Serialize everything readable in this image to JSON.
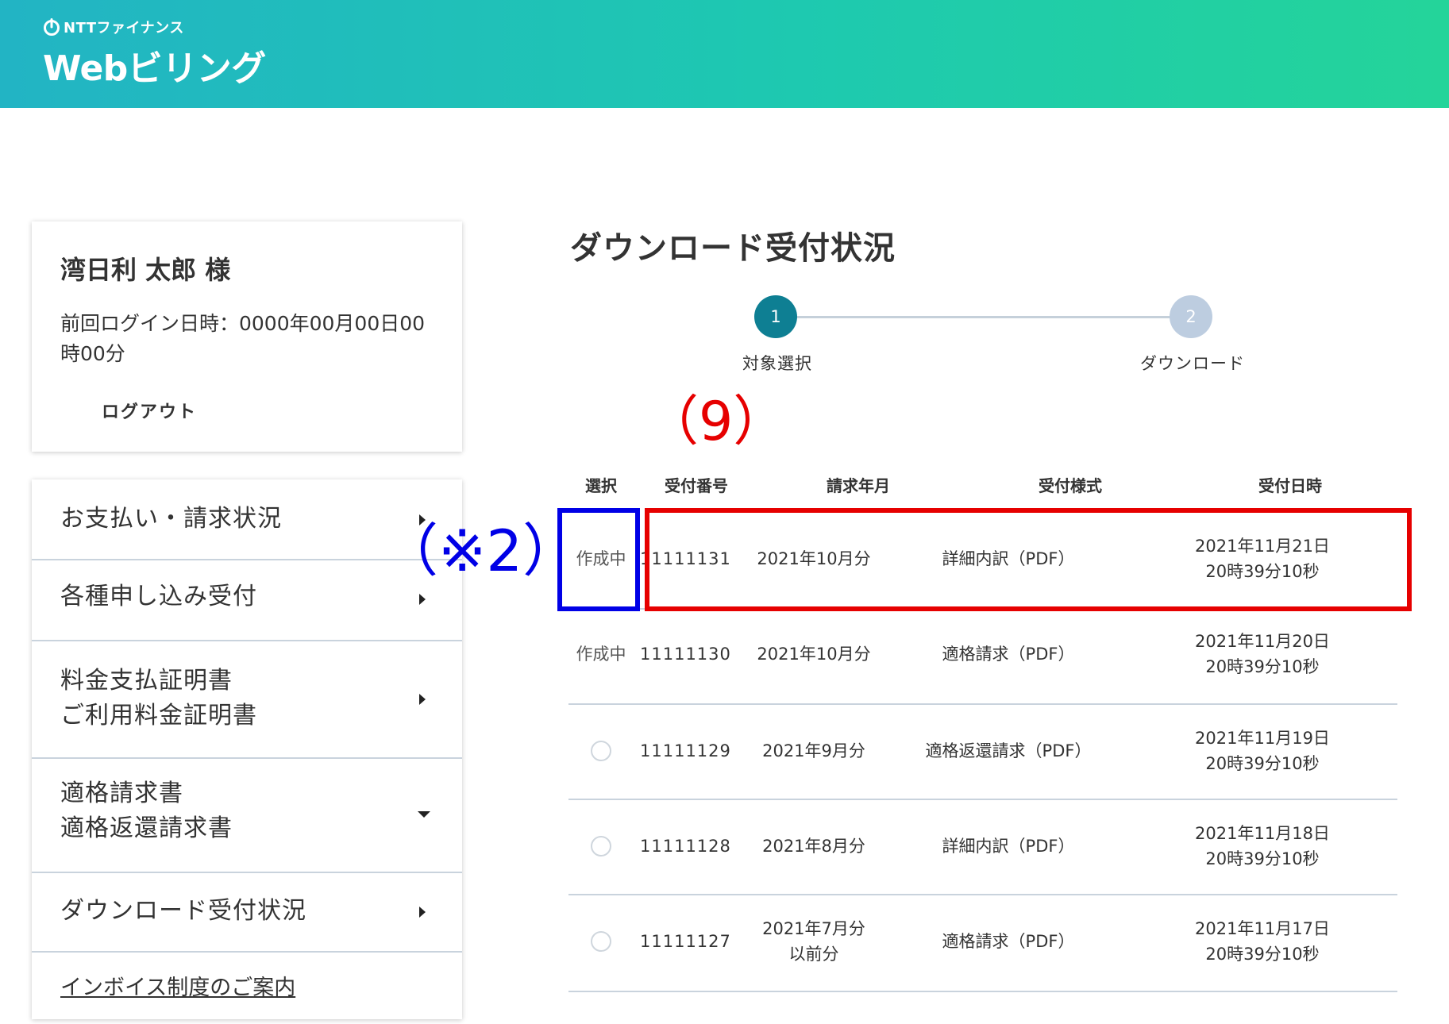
{
  "header": {
    "corp_name": "NTTファイナンス",
    "product_name": "Webビリング"
  },
  "user": {
    "name": "湾日利 太郎 様",
    "last_login": "前回ログイン日時：0000年00月00日00時00分",
    "logout_label": "ログアウト"
  },
  "sidebar": {
    "items": [
      {
        "label": "お支払い・請求状況"
      },
      {
        "label": "各種申し込み受付"
      },
      {
        "label_line1": "料金支払証明書",
        "label_line2": "ご利用料金証明書"
      },
      {
        "label_line1": "適格請求書",
        "label_line2": "適格返還請求書"
      },
      {
        "label": "ダウンロード受付状況"
      }
    ],
    "invoice_link": "インボイス制度のご案内"
  },
  "main": {
    "title": "ダウンロード受付状況",
    "steps": [
      {
        "number": "1",
        "label": "対象選択"
      },
      {
        "number": "2",
        "label": "ダウンロード"
      }
    ],
    "table": {
      "headers": [
        "選択",
        "受付番号",
        "請求年月",
        "受付様式",
        "受付日時"
      ],
      "rows": [
        {
          "select": "作成中",
          "number": "11111131",
          "month": "2021年10月分",
          "form": "詳細内訳（PDF）",
          "date_line1": "2021年11月21日",
          "date_line2": "20時39分10秒"
        },
        {
          "select": "作成中",
          "number": "11111130",
          "month": "2021年10月分",
          "form": "適格請求（PDF）",
          "date_line1": "2021年11月20日",
          "date_line2": "20時39分10秒"
        },
        {
          "select": "",
          "number": "11111129",
          "month": "2021年9月分",
          "form": "適格返還請求（PDF）",
          "date_line1": "2021年11月19日",
          "date_line2": "20時39分10秒"
        },
        {
          "select": "",
          "number": "11111128",
          "month": "2021年8月分",
          "form": "詳細内訳（PDF）",
          "date_line1": "2021年11月18日",
          "date_line2": "20時39分10秒"
        },
        {
          "select": "",
          "number": "11111127",
          "month_line1": "2021年7月分",
          "month_line2": "以前分",
          "form": "適格請求（PDF）",
          "date_line1": "2021年11月17日",
          "date_line2": "20時39分10秒"
        }
      ]
    }
  },
  "annotations": {
    "label_9": "（9）",
    "label_2": "（※2）",
    "red_color": "#e60000",
    "blue_color": "#0000e6"
  },
  "colors": {
    "header_gradient_start": "#22b4c4",
    "header_gradient_end": "#24d49a",
    "step_active": "#0e7f93",
    "step_inactive": "#bdcde0"
  }
}
